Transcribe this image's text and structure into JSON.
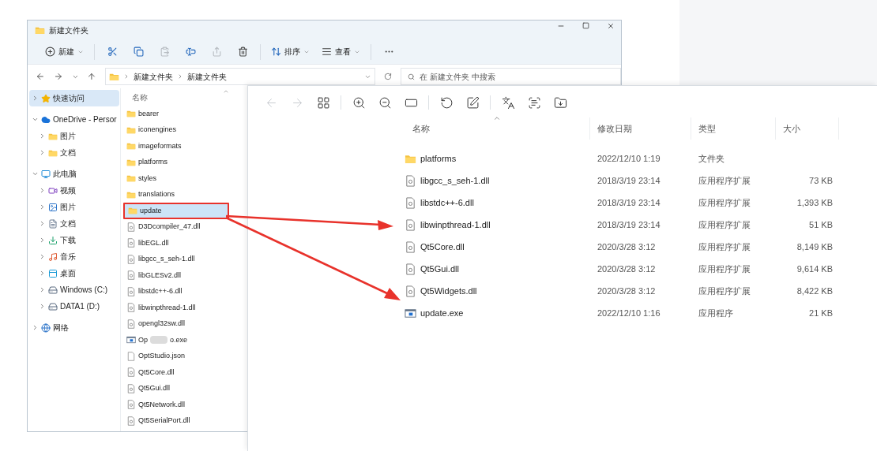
{
  "explorer": {
    "title": "新建文件夹",
    "toolbar": [
      {
        "kind": "new",
        "label": "新建",
        "disabled": false
      },
      {
        "kind": "cut",
        "disabled": false
      },
      {
        "kind": "copy",
        "disabled": false
      },
      {
        "kind": "paste",
        "disabled": true
      },
      {
        "kind": "rename",
        "disabled": false
      },
      {
        "kind": "share",
        "disabled": true
      },
      {
        "kind": "delete",
        "disabled": false
      },
      {
        "kind": "sort",
        "label": "排序",
        "disabled": false
      },
      {
        "kind": "view",
        "label": "查看",
        "disabled": false
      },
      {
        "kind": "more",
        "disabled": false
      }
    ],
    "breadcrumb": [
      "新建文件夹",
      "新建文件夹"
    ],
    "search": {
      "placeholder": "在 新建文件夹 中搜索"
    },
    "sidebar": [
      {
        "label": "快速访问",
        "kind": "star",
        "selected": true,
        "expanded": false
      },
      {
        "label": "OneDrive - Persor",
        "kind": "cloud",
        "selected": false,
        "expanded": true,
        "children": [
          {
            "label": "图片",
            "kind": "folder",
            "selected": false,
            "expanded": false
          },
          {
            "label": "文档",
            "kind": "folder",
            "selected": false,
            "expanded": false
          }
        ]
      },
      {
        "label": "此电脑",
        "kind": "monitor",
        "selected": false,
        "expanded": true,
        "children": [
          {
            "label": "视频",
            "kind": "video",
            "selected": false,
            "expanded": false
          },
          {
            "label": "图片",
            "kind": "image",
            "selected": false,
            "expanded": false
          },
          {
            "label": "文档",
            "kind": "document",
            "selected": false,
            "expanded": false
          },
          {
            "label": "下载",
            "kind": "download",
            "selected": false,
            "expanded": false
          },
          {
            "label": "音乐",
            "kind": "music",
            "selected": false,
            "expanded": false
          },
          {
            "label": "桌面",
            "kind": "desktop",
            "selected": false,
            "expanded": false
          },
          {
            "label": "Windows (C:)",
            "kind": "drive",
            "selected": false,
            "expanded": false
          },
          {
            "label": "DATA1 (D:)",
            "kind": "drive",
            "selected": false,
            "expanded": false
          }
        ]
      },
      {
        "label": "网络",
        "kind": "network",
        "selected": false,
        "expanded": false
      }
    ],
    "files": {
      "column": "名称",
      "rows": [
        {
          "name": "bearer",
          "kind": "folder",
          "selected": false
        },
        {
          "name": "iconengines",
          "kind": "folder",
          "selected": false
        },
        {
          "name": "imageformats",
          "kind": "folder",
          "selected": false
        },
        {
          "name": "platforms",
          "kind": "folder",
          "selected": false
        },
        {
          "name": "styles",
          "kind": "folder",
          "selected": false
        },
        {
          "name": "translations",
          "kind": "folder",
          "selected": false
        },
        {
          "name": "update",
          "kind": "folder",
          "selected": true
        },
        {
          "name": "D3Dcompiler_47.dll",
          "kind": "dll",
          "selected": false
        },
        {
          "name": "libEGL.dll",
          "kind": "dll",
          "selected": false
        },
        {
          "name": "libgcc_s_seh-1.dll",
          "kind": "dll",
          "selected": false
        },
        {
          "name": "libGLESv2.dll",
          "kind": "dll",
          "selected": false
        },
        {
          "name": "libstdc++-6.dll",
          "kind": "dll",
          "selected": false
        },
        {
          "name": "libwinpthread-1.dll",
          "kind": "dll",
          "selected": false
        },
        {
          "name": "opengl32sw.dll",
          "kind": "dll",
          "selected": false
        },
        {
          "name": "Op",
          "name_end": "o.exe",
          "kind": "exe",
          "selected": false
        },
        {
          "name": "OptStudio.json",
          "kind": "file",
          "selected": false
        },
        {
          "name": "Qt5Core.dll",
          "kind": "dll",
          "selected": false
        },
        {
          "name": "Qt5Gui.dll",
          "kind": "dll",
          "selected": false
        },
        {
          "name": "Qt5Network.dll",
          "kind": "dll",
          "selected": false
        },
        {
          "name": "Qt5SerialPort.dll",
          "kind": "dll",
          "selected": false
        }
      ]
    }
  },
  "viewer": {
    "toolbar": [
      {
        "kind": "back",
        "disabled": true
      },
      {
        "kind": "forward",
        "disabled": true
      },
      {
        "kind": "grid",
        "disabled": false
      },
      {
        "kind": "zoom-in",
        "disabled": false
      },
      {
        "kind": "zoom-out",
        "disabled": false
      },
      {
        "kind": "actual-size",
        "disabled": false
      },
      {
        "kind": "rotate",
        "disabled": false
      },
      {
        "kind": "edit",
        "disabled": false
      },
      {
        "kind": "translate",
        "disabled": false
      },
      {
        "kind": "scan",
        "disabled": false
      },
      {
        "kind": "save",
        "disabled": false
      }
    ],
    "columns": [
      "名称",
      "修改日期",
      "类型",
      "大小"
    ],
    "rows": [
      {
        "name": "platforms",
        "kind": "folder",
        "modified": "2022/12/10 1:19",
        "type": "文件夹"
      },
      {
        "name": "libgcc_s_seh-1.dll",
        "kind": "dll",
        "modified": "2018/3/19 23:14",
        "type": "应用程序扩展",
        "size": "73 KB"
      },
      {
        "name": "libstdc++-6.dll",
        "kind": "dll",
        "modified": "2018/3/19 23:14",
        "type": "应用程序扩展",
        "size": "1,393 KB"
      },
      {
        "name": "libwinpthread-1.dll",
        "kind": "dll",
        "modified": "2018/3/19 23:14",
        "type": "应用程序扩展",
        "size": "51 KB"
      },
      {
        "name": "Qt5Core.dll",
        "kind": "dll",
        "modified": "2020/3/28 3:12",
        "type": "应用程序扩展",
        "size": "8,149 KB"
      },
      {
        "name": "Qt5Gui.dll",
        "kind": "dll",
        "modified": "2020/3/28 3:12",
        "type": "应用程序扩展",
        "size": "9,614 KB"
      },
      {
        "name": "Qt5Widgets.dll",
        "kind": "dll",
        "modified": "2020/3/28 3:12",
        "type": "应用程序扩展",
        "size": "8,422 KB"
      },
      {
        "name": "update.exe",
        "kind": "exe",
        "modified": "2022/12/10 1:16",
        "type": "应用程序",
        "size": "21 KB"
      }
    ]
  }
}
